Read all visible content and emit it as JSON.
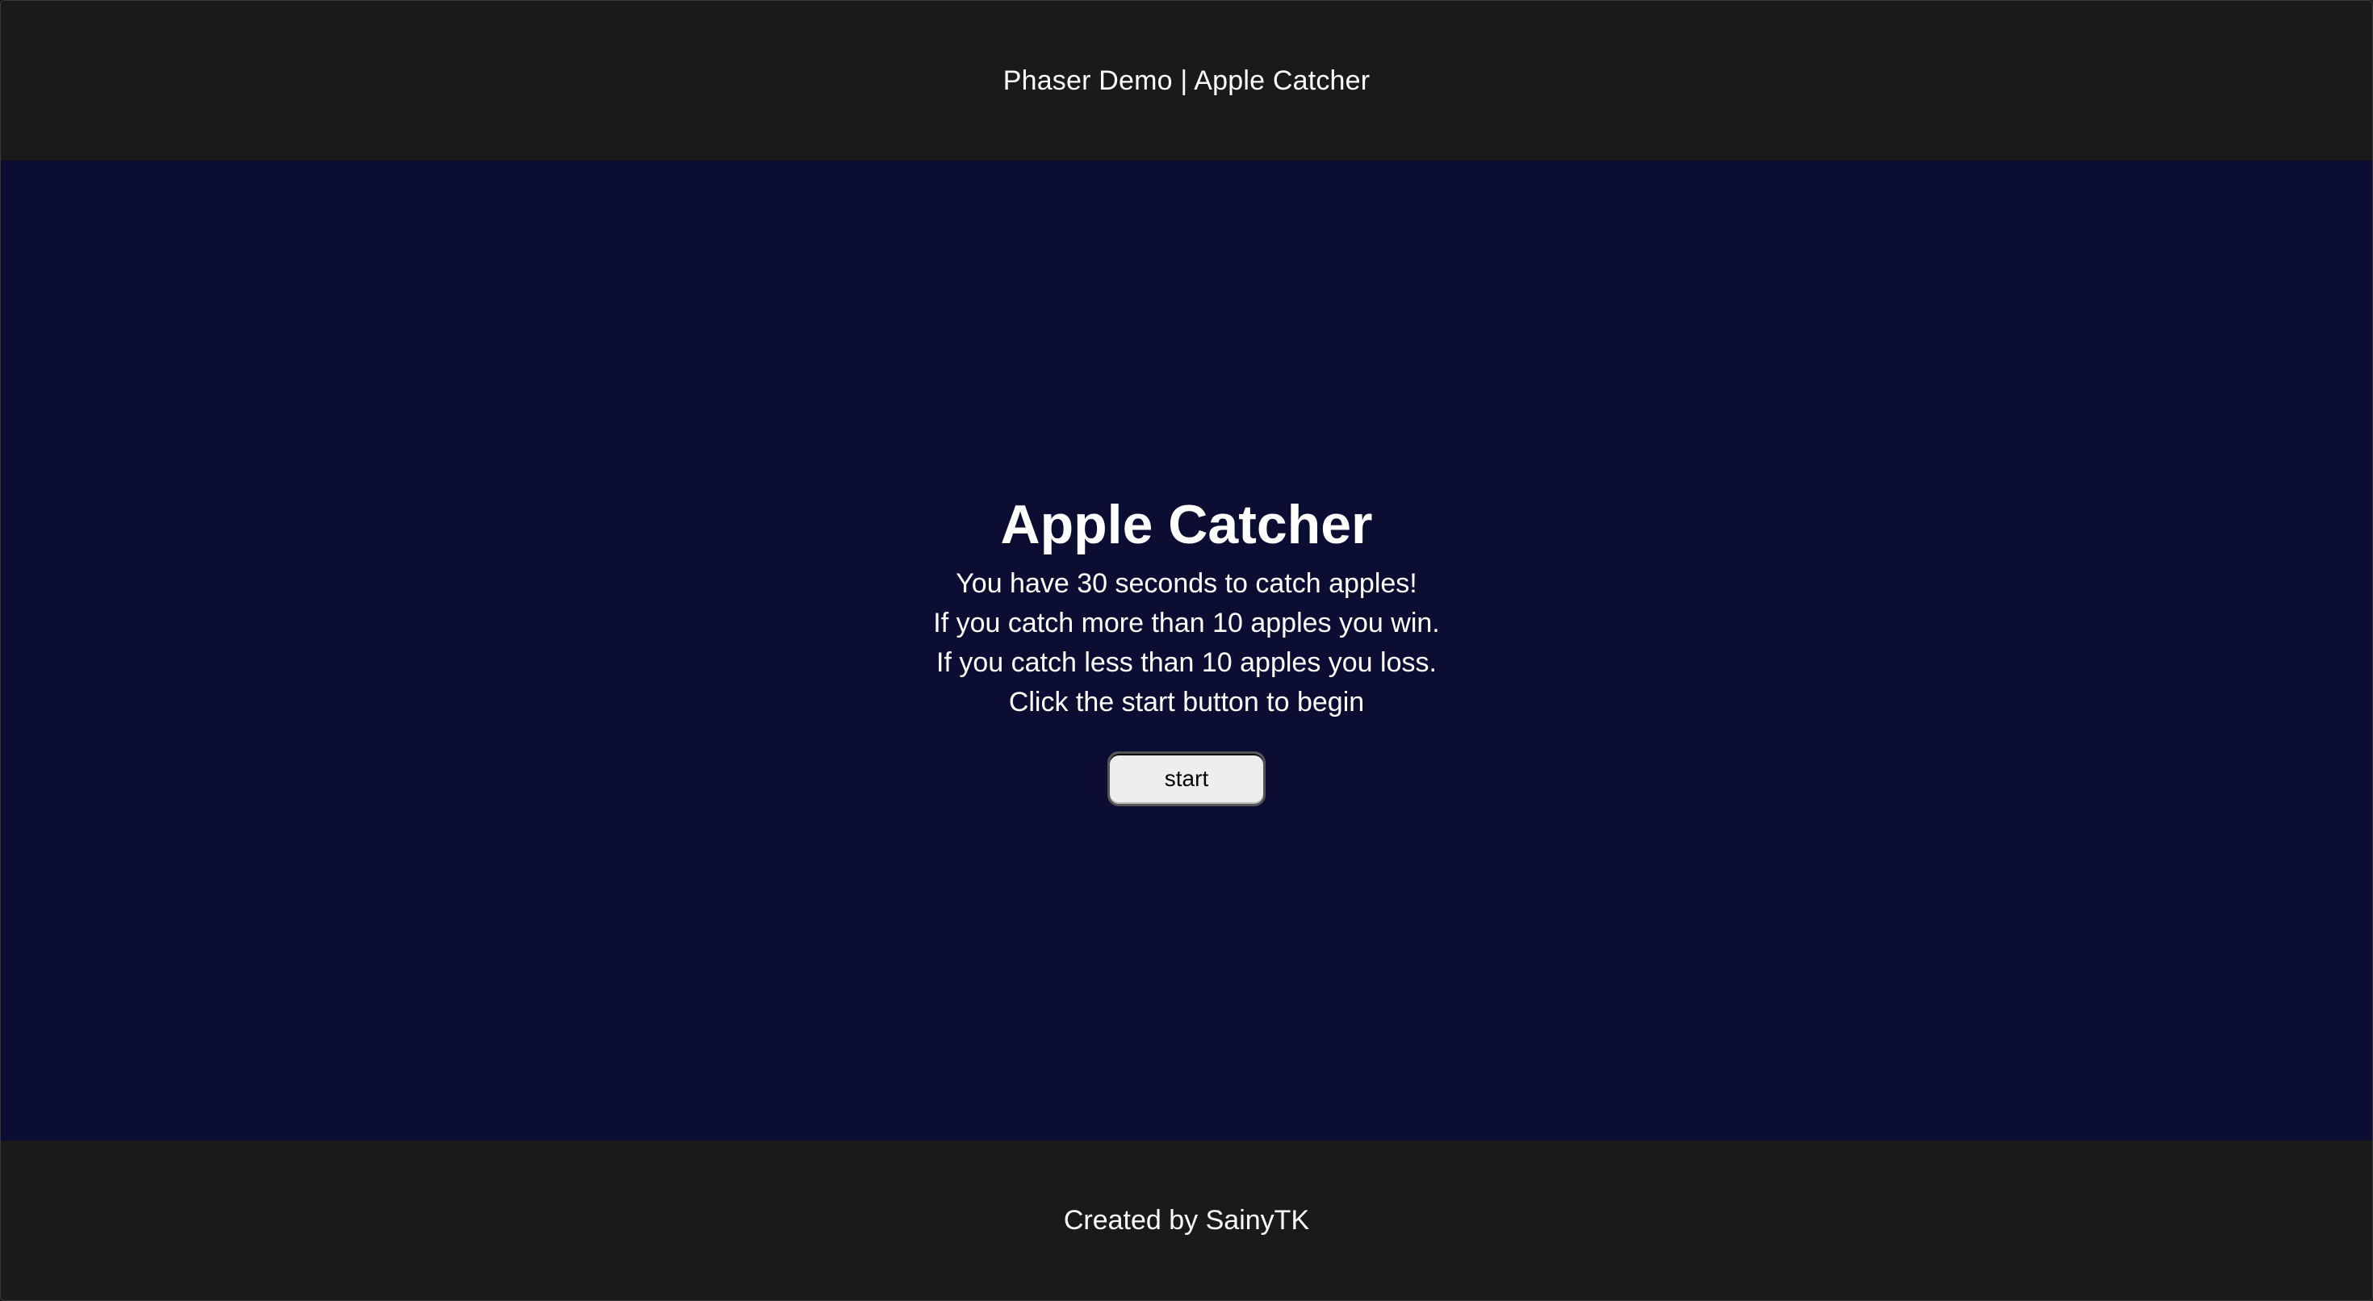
{
  "header": {
    "title": "Phaser Demo | Apple Catcher"
  },
  "game": {
    "title": "Apple Catcher",
    "rules": [
      "You have 30 seconds to catch apples!",
      "If you catch more than 10 apples you win.",
      "If you catch less than 10 apples you loss.",
      "Click the start button to begin"
    ],
    "start_label": "start"
  },
  "footer": {
    "credit": "Created by SainyTK"
  },
  "colors": {
    "page_background": "#1a1a1a",
    "game_background": "#0c0d33",
    "button_background": "#eeeeee"
  }
}
